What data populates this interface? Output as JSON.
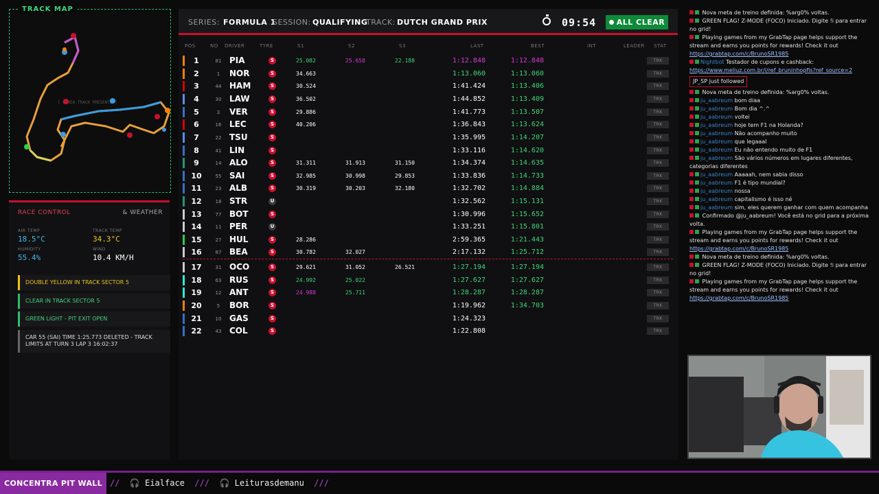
{
  "track_map": {
    "title": "TRACK MAP",
    "hint": "[ PAREA TRACK PRESENTE ]"
  },
  "race_control": {
    "tab_active": "RACE CONTROL",
    "tab_other": "& WEATHER",
    "weather": [
      {
        "label": "AIR TEMP",
        "value": "18.5°C",
        "color": "#41b8e8"
      },
      {
        "label": "TRACK TEMP",
        "value": "34.3°C",
        "color": "#f0c419"
      },
      {
        "label": "HUMIDITY",
        "value": "55.4%",
        "color": "#41b8e8"
      },
      {
        "label": "WIND",
        "value": "10.4 KM/H",
        "color": "#ffffff"
      }
    ],
    "messages": [
      {
        "text": "DOUBLE YELLOW IN TRACK SECTOR 5",
        "color": "#f0c419",
        "border": "#f0c419"
      },
      {
        "text": "CLEAR IN TRACK SECTOR 5",
        "color": "#41d67a",
        "border": "#2fbf6a"
      },
      {
        "text": "GREEN LIGHT - PIT EXIT OPEN",
        "color": "#41d67a",
        "border": "#2fbf6a"
      },
      {
        "text": "CAR 55 (SAI) TIME 1:25.773 DELETED - TRACK LIMITS AT TURN 3 LAP 3 16:02:37",
        "color": "#dddddd",
        "border": "#666666"
      }
    ]
  },
  "header": {
    "series_key": "SERIES:",
    "series": "FORMULA 1",
    "session_key": "SESSION:",
    "session": "QUALIFYING",
    "track_key": "TRACK:",
    "track": "DUTCH GRAND PRIX",
    "clock": "09:54",
    "status": "ALL CLEAR"
  },
  "columns": {
    "pos": "POS",
    "no": "NO",
    "driver": "DRIVER",
    "tyre": "TYRE",
    "s1": "S1",
    "s2": "S2",
    "s3": "S3",
    "last": "LAST",
    "best": "BEST",
    "int": "INT",
    "leader": "LEADER",
    "stat": "STAT"
  },
  "trk_label": "TRK",
  "rows": [
    {
      "pos": "1",
      "no": "81",
      "drv": "PIA",
      "tyre": "S",
      "s1": "25.082",
      "s1c": "#41d67a",
      "s2": "25.658",
      "s2c": "#d63ad6",
      "s3": "22.188",
      "s3c": "#41d67a",
      "last": "1:12.848",
      "lastc": "#d63ad6",
      "best": "1:12.848",
      "bestc": "#d63ad6",
      "team": "#ff8000"
    },
    {
      "pos": "2",
      "no": "1",
      "drv": "NOR",
      "tyre": "S",
      "s1": "34.663",
      "s1c": "#ffffff",
      "s2": "",
      "s2c": "",
      "s3": "",
      "s3c": "",
      "last": "1:13.060",
      "lastc": "#41d67a",
      "best": "1:13.060",
      "bestc": "#41d67a",
      "team": "#ff8000"
    },
    {
      "pos": "3",
      "no": "44",
      "drv": "HAM",
      "tyre": "S",
      "s1": "30.524",
      "s1c": "#ffffff",
      "s2": "",
      "s2c": "",
      "s3": "",
      "s3c": "",
      "last": "1:41.424",
      "lastc": "#ffffff",
      "best": "1:13.406",
      "bestc": "#41d67a",
      "team": "#dc0000"
    },
    {
      "pos": "4",
      "no": "30",
      "drv": "LAW",
      "tyre": "S",
      "s1": "36.502",
      "s1c": "#ffffff",
      "s2": "",
      "s2c": "",
      "s3": "",
      "s3c": "",
      "last": "1:44.852",
      "lastc": "#ffffff",
      "best": "1:13.409",
      "bestc": "#41d67a",
      "team": "#5a8ee8"
    },
    {
      "pos": "5",
      "no": "3",
      "drv": "VER",
      "tyre": "S",
      "s1": "29.886",
      "s1c": "#ffffff",
      "s2": "",
      "s2c": "",
      "s3": "",
      "s3c": "",
      "last": "1:41.773",
      "lastc": "#ffffff",
      "best": "1:13.507",
      "bestc": "#41d67a",
      "team": "#3671c6"
    },
    {
      "pos": "6",
      "no": "16",
      "drv": "LEC",
      "tyre": "S",
      "s1": "40.206",
      "s1c": "#ffffff",
      "s2": "",
      "s2c": "",
      "s3": "",
      "s3c": "",
      "last": "1:36.843",
      "lastc": "#ffffff",
      "best": "1:13.624",
      "bestc": "#41d67a",
      "team": "#dc0000"
    },
    {
      "pos": "7",
      "no": "22",
      "drv": "TSU",
      "tyre": "S",
      "s1": "",
      "s1c": "",
      "s2": "",
      "s2c": "",
      "s3": "",
      "s3c": "",
      "last": "1:35.995",
      "lastc": "#ffffff",
      "best": "1:14.207",
      "bestc": "#41d67a",
      "team": "#5a8ee8"
    },
    {
      "pos": "8",
      "no": "41",
      "drv": "LIN",
      "tyre": "S",
      "s1": "",
      "s1c": "",
      "s2": "",
      "s2c": "",
      "s3": "",
      "s3c": "",
      "last": "1:33.116",
      "lastc": "#ffffff",
      "best": "1:14.620",
      "bestc": "#41d67a",
      "team": "#3671c6"
    },
    {
      "pos": "9",
      "no": "14",
      "drv": "ALO",
      "tyre": "S",
      "s1": "31.311",
      "s1c": "#ffffff",
      "s2": "31.913",
      "s2c": "#ffffff",
      "s3": "31.150",
      "s3c": "#ffffff",
      "last": "1:34.374",
      "lastc": "#ffffff",
      "best": "1:14.635",
      "bestc": "#41d67a",
      "team": "#229971"
    },
    {
      "pos": "10",
      "no": "55",
      "drv": "SAI",
      "tyre": "S",
      "s1": "32.985",
      "s1c": "#ffffff",
      "s2": "30.998",
      "s2c": "#ffffff",
      "s3": "29.853",
      "s3c": "#ffffff",
      "last": "1:33.836",
      "lastc": "#ffffff",
      "best": "1:14.733",
      "bestc": "#41d67a",
      "team": "#3671c6"
    },
    {
      "pos": "11",
      "no": "23",
      "drv": "ALB",
      "tyre": "S",
      "s1": "30.319",
      "s1c": "#ffffff",
      "s2": "30.203",
      "s2c": "#ffffff",
      "s3": "32.180",
      "s3c": "#ffffff",
      "last": "1:32.702",
      "lastc": "#ffffff",
      "best": "1:14.884",
      "bestc": "#41d67a",
      "team": "#3671c6"
    },
    {
      "pos": "12",
      "no": "18",
      "drv": "STR",
      "tyre": "U",
      "s1": "",
      "s1c": "",
      "s2": "",
      "s2c": "",
      "s3": "",
      "s3c": "",
      "last": "1:32.562",
      "lastc": "#ffffff",
      "best": "1:15.131",
      "bestc": "#41d67a",
      "team": "#229971"
    },
    {
      "pos": "13",
      "no": "77",
      "drv": "BOT",
      "tyre": "S",
      "s1": "",
      "s1c": "",
      "s2": "",
      "s2c": "",
      "s3": "",
      "s3c": "",
      "last": "1:30.996",
      "lastc": "#ffffff",
      "best": "1:15.652",
      "bestc": "#41d67a",
      "team": "#cccccc"
    },
    {
      "pos": "14",
      "no": "11",
      "drv": "PER",
      "tyre": "U",
      "s1": "",
      "s1c": "",
      "s2": "",
      "s2c": "",
      "s3": "",
      "s3c": "",
      "last": "1:33.251",
      "lastc": "#ffffff",
      "best": "1:15.801",
      "bestc": "#41d67a",
      "team": "#cccccc"
    },
    {
      "pos": "15",
      "no": "27",
      "drv": "HUL",
      "tyre": "S",
      "s1": "28.286",
      "s1c": "#ffffff",
      "s2": "",
      "s2c": "",
      "s3": "",
      "s3c": "",
      "last": "2:59.365",
      "lastc": "#ffffff",
      "best": "1:21.443",
      "bestc": "#41d67a",
      "team": "#2ad14a"
    },
    {
      "pos": "16",
      "no": "87",
      "drv": "BEA",
      "tyre": "S",
      "s1": "30.782",
      "s1c": "#ffffff",
      "s2": "32.027",
      "s2c": "#ffffff",
      "s3": "",
      "s3c": "",
      "last": "2:17.132",
      "lastc": "#ffffff",
      "best": "1:25.712",
      "bestc": "#41d67a",
      "team": "#cccccc"
    },
    {
      "pos": "17",
      "no": "31",
      "drv": "OCO",
      "tyre": "S",
      "s1": "29.621",
      "s1c": "#ffffff",
      "s2": "31.052",
      "s2c": "#ffffff",
      "s3": "26.521",
      "s3c": "#ffffff",
      "last": "1:27.194",
      "lastc": "#41d67a",
      "best": "1:27.194",
      "bestc": "#41d67a",
      "team": "#cccccc"
    },
    {
      "pos": "18",
      "no": "63",
      "drv": "RUS",
      "tyre": "S",
      "s1": "24.992",
      "s1c": "#41d67a",
      "s2": "25.022",
      "s2c": "#41d67a",
      "s3": "",
      "s3c": "",
      "last": "1:27.627",
      "lastc": "#41d67a",
      "best": "1:27.627",
      "bestc": "#41d67a",
      "team": "#27f4d2"
    },
    {
      "pos": "19",
      "no": "12",
      "drv": "ANT",
      "tyre": "S",
      "s1": "24.988",
      "s1c": "#d63ad6",
      "s2": "25.711",
      "s2c": "#41d67a",
      "s3": "",
      "s3c": "",
      "last": "1:28.287",
      "lastc": "#41d67a",
      "best": "1:28.287",
      "bestc": "#41d67a",
      "team": "#27f4d2"
    },
    {
      "pos": "20",
      "no": "5",
      "drv": "BOR",
      "tyre": "S",
      "s1": "",
      "s1c": "",
      "s2": "",
      "s2c": "",
      "s3": "",
      "s3c": "",
      "last": "1:19.962",
      "lastc": "#ffffff",
      "best": "1:34.703",
      "bestc": "#41d67a",
      "team": "#ff8000"
    },
    {
      "pos": "21",
      "no": "10",
      "drv": "GAS",
      "tyre": "S",
      "s1": "",
      "s1c": "",
      "s2": "",
      "s2c": "",
      "s3": "",
      "s3c": "",
      "last": "1:24.323",
      "lastc": "#ffffff",
      "best": "",
      "bestc": "",
      "team": "#3671c6"
    },
    {
      "pos": "22",
      "no": "43",
      "drv": "COL",
      "tyre": "S",
      "s1": "",
      "s1c": "",
      "s2": "",
      "s2c": "",
      "s3": "",
      "s3c": "",
      "last": "1:22.808",
      "lastc": "#ffffff",
      "best": "",
      "bestc": "",
      "team": "#3671c6"
    }
  ],
  "chat": {
    "lines": [
      {
        "user": "",
        "text": "Nova meta de treino definida: %arg0% voltas."
      },
      {
        "user": "",
        "text": "GREEN FLAG! Z-MODE (FOCO) Iniciado. Digite !i para entrar no grid!"
      },
      {
        "user": "",
        "text": "Playing games from my GrabTap page helps support the stream and earns you points for rewards! Check it out",
        "link": "https://grabtap.com/c/BrunoSR1985"
      },
      {
        "user": "Nightbot",
        "text": "Testador de cupons e cashback:",
        "link": "https://www.meliuz.com.br/i/ref_bruninhopfis?ref_source=2"
      },
      {
        "user": "JP_SP",
        "text": "just followed",
        "follow": true
      },
      {
        "user": "",
        "text": "Nova meta de treino definida: %arg0% voltas."
      },
      {
        "user": "ju_aabreum",
        "text": "bom diaa"
      },
      {
        "user": "ju_aabreum",
        "text": "Bom dia ^.^"
      },
      {
        "user": "ju_aabreum",
        "text": "voltei"
      },
      {
        "user": "ju_aabreum",
        "text": "hoje tem F1 na Holanda?"
      },
      {
        "user": "ju_aabreum",
        "text": "Não acompanho muito"
      },
      {
        "user": "ju_aabreum",
        "text": "que legaaal"
      },
      {
        "user": "ju_aabreum",
        "text": "Eu não entendo muito de F1"
      },
      {
        "user": "ju_aabreum",
        "text": "São vários números em lugares diferentes, categorias diferentes"
      },
      {
        "user": "ju_aabreum",
        "text": "Aaaaah, nem sabia disso"
      },
      {
        "user": "ju_aabreum",
        "text": "F1 é tipo mundial?"
      },
      {
        "user": "ju_aabreum",
        "text": "nossa"
      },
      {
        "user": "ju_aabreum",
        "text": "capitalismo é isso né"
      },
      {
        "user": "ju_aabreum",
        "text": "sim, eles querem ganhar com quem acompanha"
      },
      {
        "user": "",
        "text": "Confirmado @ju_aabreum! Você está no grid para a próxima volta."
      },
      {
        "user": "",
        "text": "Playing games from my GrabTap page helps support the stream and earns you points for rewards! Check it out",
        "link": "https://grabtap.com/c/BrunoSR1985"
      },
      {
        "user": "",
        "text": "Nova meta de treino definida: %arg0% voltas."
      },
      {
        "user": "",
        "text": "GREEN FLAG! Z-MODE (FOCO) Iniciado. Digite !i para entrar no grid!"
      },
      {
        "user": "",
        "text": "Playing games from my GrabTap page helps support the stream and earns you points for rewards! Check it out",
        "link": "https://grabtap.com/c/BrunoSR1985"
      }
    ]
  },
  "bottom_bar": {
    "brand": "CONCENTRA PIT WALL",
    "items": [
      "Eialface",
      "Leiturasdemanu"
    ]
  }
}
